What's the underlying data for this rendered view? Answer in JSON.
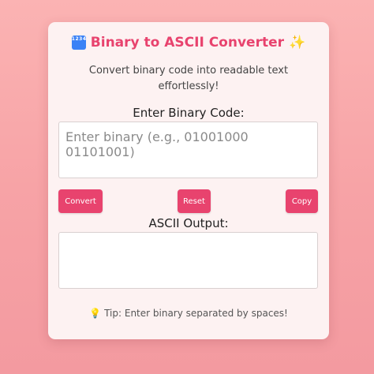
{
  "header": {
    "icon": "input-numbers-icon",
    "icon_text": "1234",
    "title": "Binary to ASCII Converter",
    "trailing_icon": "sparkles-icon",
    "trailing_glyph": "✨",
    "subtitle": "Convert binary code into readable text effortlessly!"
  },
  "input_section": {
    "label": "Enter Binary Code:",
    "placeholder": "Enter binary (e.g., 01001000 01101001)",
    "value": ""
  },
  "buttons": {
    "convert": "Convert",
    "reset": "Reset",
    "copy": "Copy"
  },
  "output_section": {
    "label": "ASCII Output:",
    "value": ""
  },
  "tip": {
    "icon": "lightbulb-icon",
    "glyph": "💡",
    "text": "Tip: Enter binary separated by spaces!"
  },
  "colors": {
    "accent": "#e8436e",
    "background": "#f7a3a6",
    "card": "#fdf2f2"
  }
}
